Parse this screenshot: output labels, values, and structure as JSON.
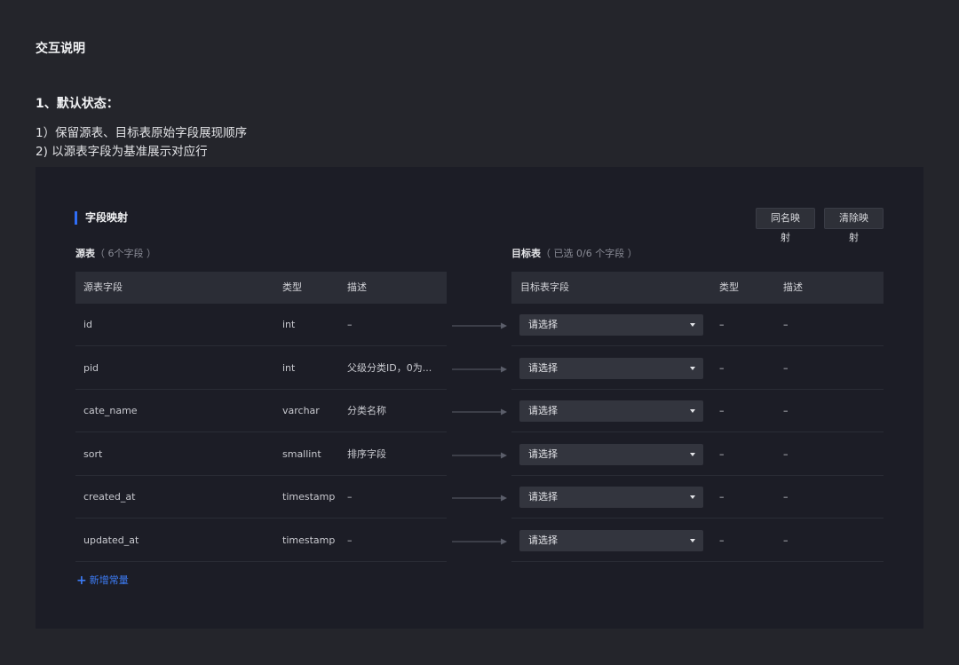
{
  "doc": {
    "title": "交互说明",
    "section": "1、默认状态：",
    "notes": [
      "1）保留源表、目标表原始字段展现顺序",
      "2) 以源表字段为基准展示对应行"
    ]
  },
  "panel": {
    "title": "字段映射",
    "buttons": {
      "same_name": "同名映射",
      "clear": "清除映射"
    },
    "source": {
      "label": "源表",
      "hint": "（ 6个字段 ）",
      "columns": [
        "源表字段",
        "类型",
        "描述"
      ],
      "rows": [
        {
          "field": "id",
          "type": "int",
          "desc": "–"
        },
        {
          "field": "pid",
          "type": "int",
          "desc": "父级分类ID，0为..."
        },
        {
          "field": "cate_name",
          "type": "varchar",
          "desc": "分类名称"
        },
        {
          "field": "sort",
          "type": "smallint",
          "desc": "排序字段"
        },
        {
          "field": "created_at",
          "type": "timestamp",
          "desc": "–"
        },
        {
          "field": "updated_at",
          "type": "timestamp",
          "desc": "–"
        }
      ]
    },
    "target": {
      "label": "目标表",
      "hint": "（ 已选 0/6 个字段 ）",
      "columns": [
        "目标表字段",
        "类型",
        "描述"
      ],
      "rows": [
        {
          "select": "请选择",
          "type": "–",
          "desc": "–"
        },
        {
          "select": "请选择",
          "type": "–",
          "desc": "–"
        },
        {
          "select": "请选择",
          "type": "–",
          "desc": "–"
        },
        {
          "select": "请选择",
          "type": "–",
          "desc": "–"
        },
        {
          "select": "请选择",
          "type": "–",
          "desc": "–"
        },
        {
          "select": "请选择",
          "type": "–",
          "desc": "–"
        }
      ]
    },
    "add_constant": "新增常量",
    "colors": {
      "accent": "#2f6df6",
      "link": "#3d7cf5",
      "panel_bg": "#1c1d26",
      "page_bg": "#24252b"
    }
  }
}
